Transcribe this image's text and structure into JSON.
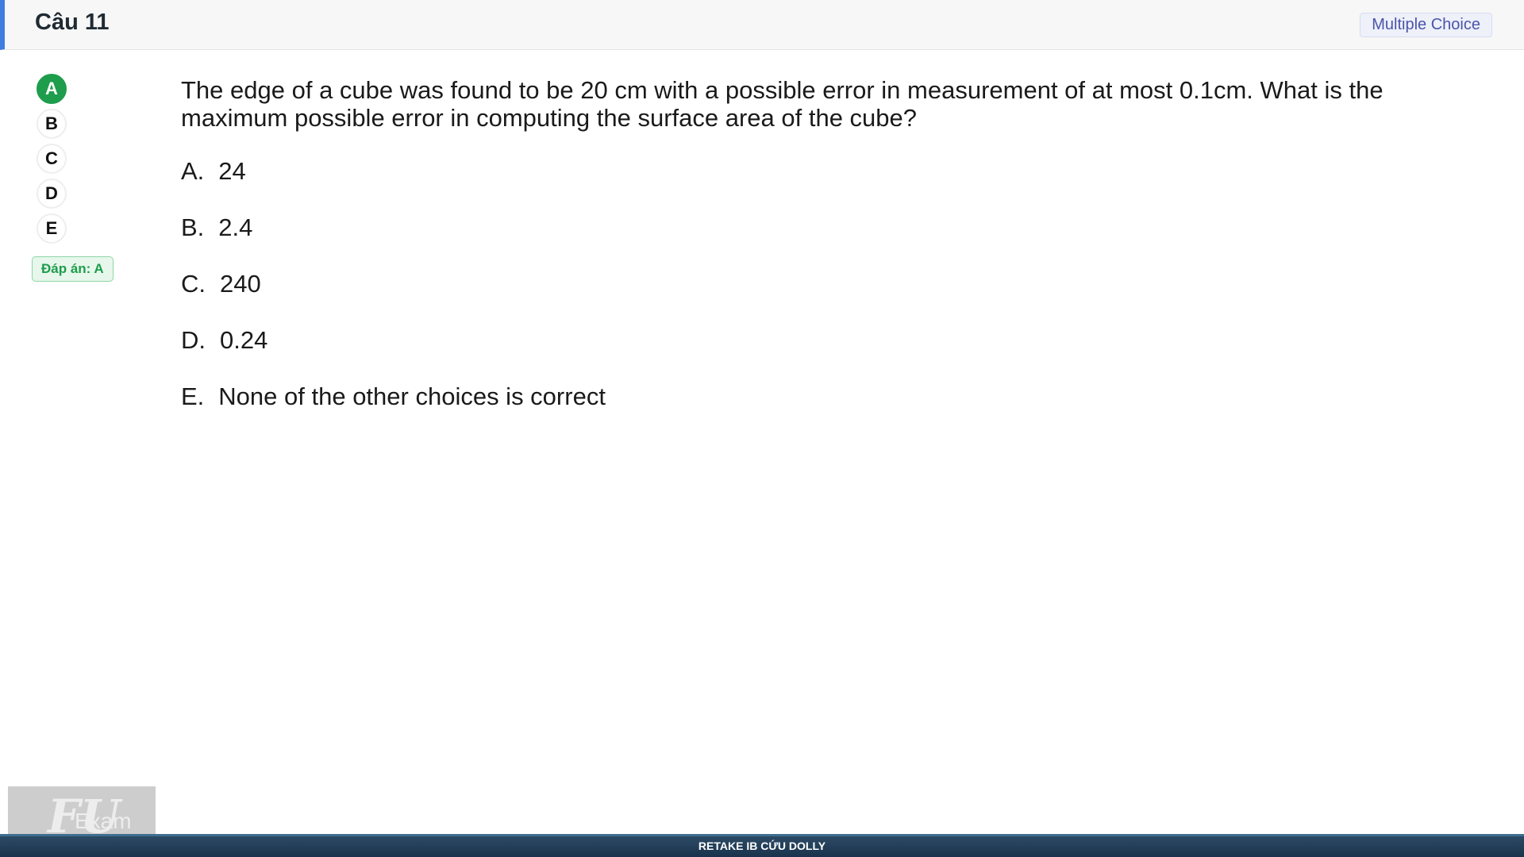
{
  "header": {
    "title": "Câu 11",
    "question_type": "Multiple Choice"
  },
  "choices": {
    "bubbles": [
      "A",
      "B",
      "C",
      "D",
      "E"
    ],
    "selected": "A",
    "answer_tag": "Đáp án: A"
  },
  "question": {
    "text": "The edge of a cube was found to be 20 cm with a possible error in measurement of  at most 0.1cm. What is the maximum possible error in computing the surface area of the cube?",
    "options": [
      {
        "letter": "A.",
        "text": "24"
      },
      {
        "letter": "B.",
        "text": "2.4"
      },
      {
        "letter": "C.",
        "text": "240"
      },
      {
        "letter": "D.",
        "text": "0.24"
      },
      {
        "letter": "E.",
        "text": "None of the other choices is correct"
      }
    ]
  },
  "logo": {
    "mark": "FU",
    "word": "Exam"
  },
  "footer": {
    "text": "RETAKE IB CỨU DOLLY"
  },
  "colors": {
    "accent": "#3d7de0",
    "correct": "#1e9d4c",
    "footer": "#1b334c"
  }
}
